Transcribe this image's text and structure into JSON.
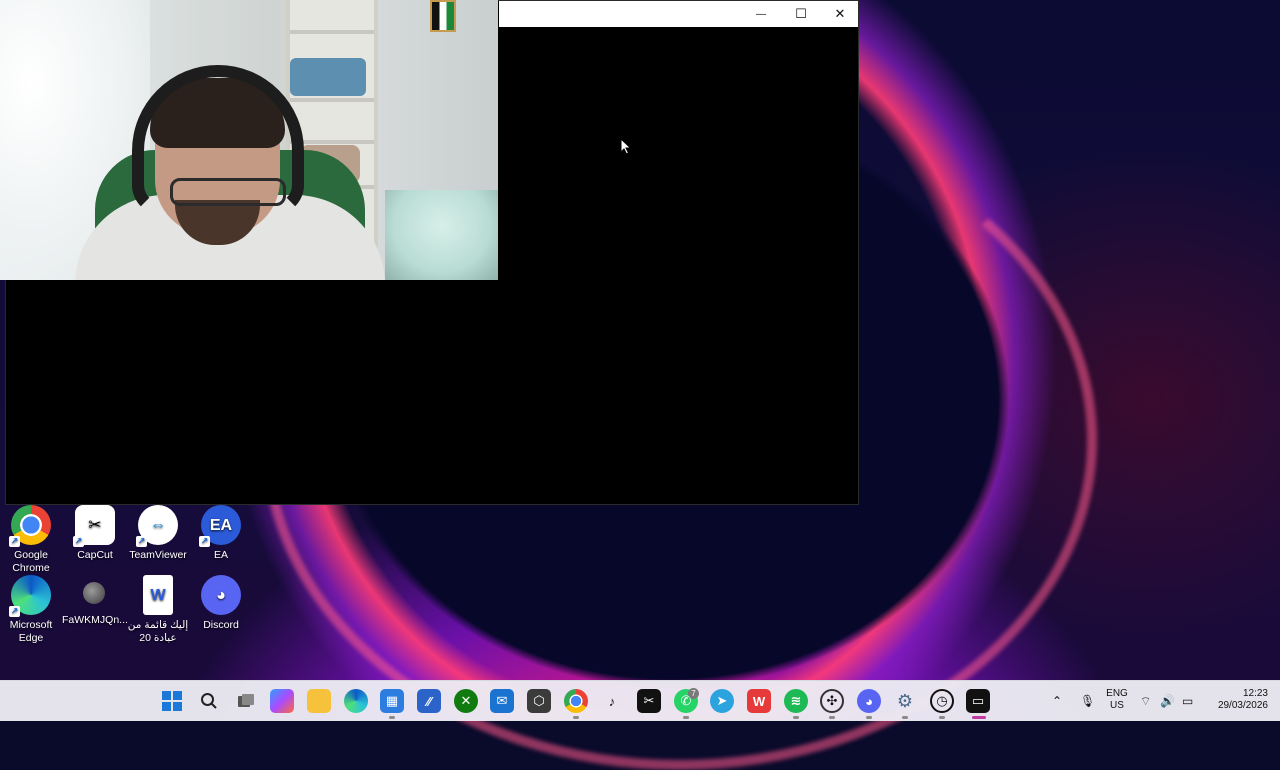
{
  "desktop": {
    "icons": [
      {
        "label": "Google\nChrome",
        "icon": "chrome-icon"
      },
      {
        "label": "CapCut",
        "icon": "capcut-icon"
      },
      {
        "label": "TeamViewer",
        "icon": "teamviewer-icon"
      },
      {
        "label": "EA",
        "icon": "ea-icon"
      },
      {
        "label": "Microsoft\nEdge",
        "icon": "edge-icon"
      },
      {
        "label": "FaWKMJQn...",
        "icon": "globe-file-icon"
      },
      {
        "label": "إليك قائمة من\nعبادة 20",
        "icon": "word-document-icon"
      },
      {
        "label": "Discord",
        "icon": "discord-icon"
      }
    ]
  },
  "console_window": {
    "minimize": "—",
    "maximize": "☐",
    "close": "✕"
  },
  "taskbar": {
    "apps": [
      "start-icon",
      "search-icon",
      "task-view-icon",
      "copilot-icon",
      "file-explorer-icon",
      "edge-icon",
      "microsoft-store-icon",
      "app-icon",
      "xbox-icon",
      "outlook-icon",
      "unity-icon",
      "chrome-icon",
      "tiktok-icon",
      "capcut-icon",
      "whatsapp-icon",
      "telegram-icon",
      "wps-office-icon",
      "spotify-icon",
      "chatgpt-icon",
      "discord-icon",
      "settings-icon",
      "clock-app-icon",
      "terminal-icon"
    ],
    "whatsapp_badge": "7",
    "language_line1": "ENG",
    "language_line2": "US",
    "time": "12:23",
    "date": "29/03/2026"
  },
  "colors": {
    "accent": "#e0307a",
    "taskbar": "#ececf2"
  }
}
